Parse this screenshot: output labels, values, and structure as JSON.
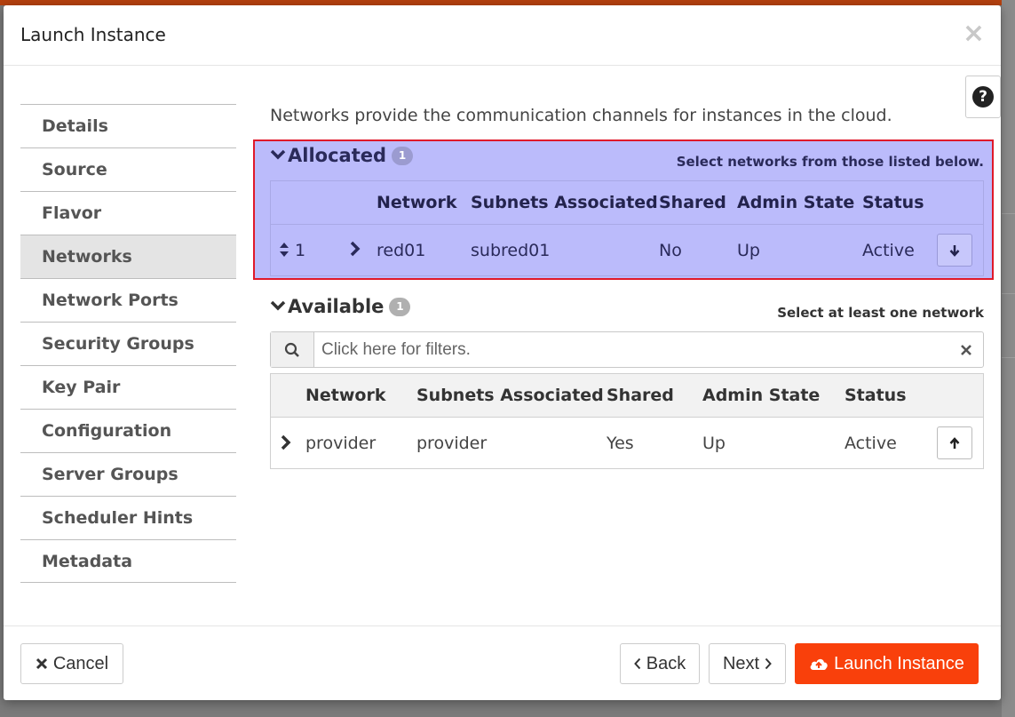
{
  "modal": {
    "title": "Launch Instance",
    "close_glyph": "×",
    "help_glyph": "?"
  },
  "sidebar": {
    "items": [
      {
        "label": "Details",
        "active": false
      },
      {
        "label": "Source",
        "active": false
      },
      {
        "label": "Flavor",
        "active": false
      },
      {
        "label": "Networks",
        "active": true
      },
      {
        "label": "Network Ports",
        "active": false
      },
      {
        "label": "Security Groups",
        "active": false
      },
      {
        "label": "Key Pair",
        "active": false
      },
      {
        "label": "Configuration",
        "active": false
      },
      {
        "label": "Server Groups",
        "active": false
      },
      {
        "label": "Scheduler Hints",
        "active": false
      },
      {
        "label": "Metadata",
        "active": false
      }
    ]
  },
  "main": {
    "intro": "Networks provide the communication channels for instances in the cloud.",
    "allocated": {
      "title": "Allocated",
      "count": "1",
      "hint": "Select networks from those listed below.",
      "columns": [
        "Network",
        "Subnets Associated",
        "Shared",
        "Admin State",
        "Status"
      ],
      "rows": [
        {
          "order": "1",
          "network": "red01",
          "subnets": "subred01",
          "shared": "No",
          "admin_state": "Up",
          "status": "Active"
        }
      ]
    },
    "available": {
      "title": "Available",
      "count": "1",
      "hint": "Select at least one network",
      "filter_placeholder": "Click here for filters.",
      "columns": [
        "Network",
        "Subnets Associated",
        "Shared",
        "Admin State",
        "Status"
      ],
      "rows": [
        {
          "network": "provider",
          "subnets": "provider",
          "shared": "Yes",
          "admin_state": "Up",
          "status": "Active"
        }
      ]
    }
  },
  "footer": {
    "cancel_label": "Cancel",
    "back_label": "Back",
    "next_label": "Next",
    "launch_label": "Launch Instance"
  },
  "colors": {
    "accent": "#f9400b",
    "highlight_fill": "#bbbbfb",
    "highlight_border": "#e0192a"
  },
  "icons": [
    "close-icon",
    "help-icon",
    "chevron-down-icon",
    "chevron-right-icon",
    "sort-icon",
    "arrow-down-icon",
    "arrow-up-icon",
    "search-icon",
    "clear-icon",
    "cloud-upload-icon"
  ]
}
